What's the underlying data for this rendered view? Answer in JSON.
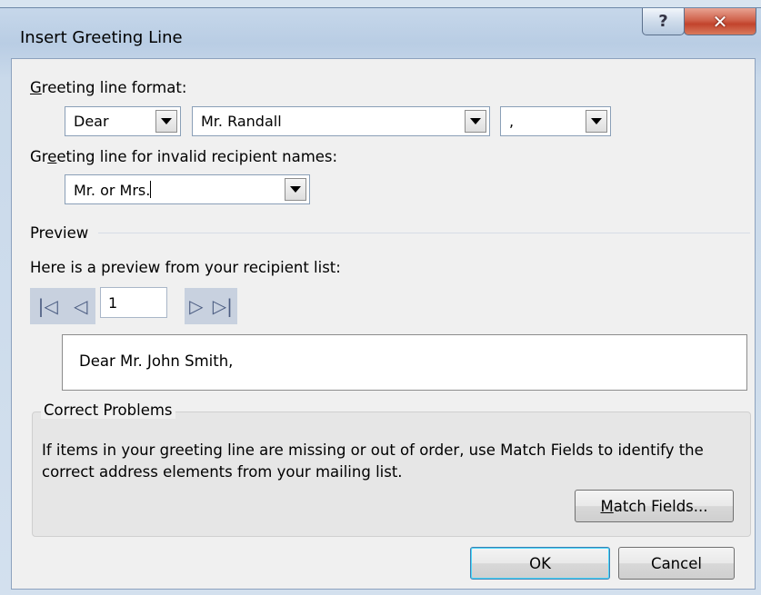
{
  "window": {
    "title": "Insert Greeting Line"
  },
  "greeting_format": {
    "label_underline": "G",
    "label_rest": "reeting line format:",
    "salutation": "Dear",
    "name_format": "Mr. Randall",
    "punctuation": ","
  },
  "invalid_names": {
    "label_pre": "Gr",
    "label_underline": "e",
    "label_post": "eting line for invalid recipient names:",
    "value": "Mr. or Mrs."
  },
  "preview": {
    "section_label": "Preview",
    "intro": "Here is a preview from your recipient list:",
    "record_number": "1",
    "text": "Dear Mr. John Smith,"
  },
  "nav_icons": [
    "first-record-icon",
    "previous-record-icon",
    "next-record-icon",
    "last-record-icon"
  ],
  "correct_problems": {
    "legend": "Correct Problems",
    "description": "If items in your greeting line are missing or out of order, use Match Fields to identify the correct address elements from your mailing list.",
    "match_underline": "M",
    "match_rest": "atch Fields..."
  },
  "buttons": {
    "ok": "OK",
    "cancel": "Cancel"
  },
  "colors": {
    "close_button": "#c2432c",
    "nav_background": "#c8d1df"
  }
}
